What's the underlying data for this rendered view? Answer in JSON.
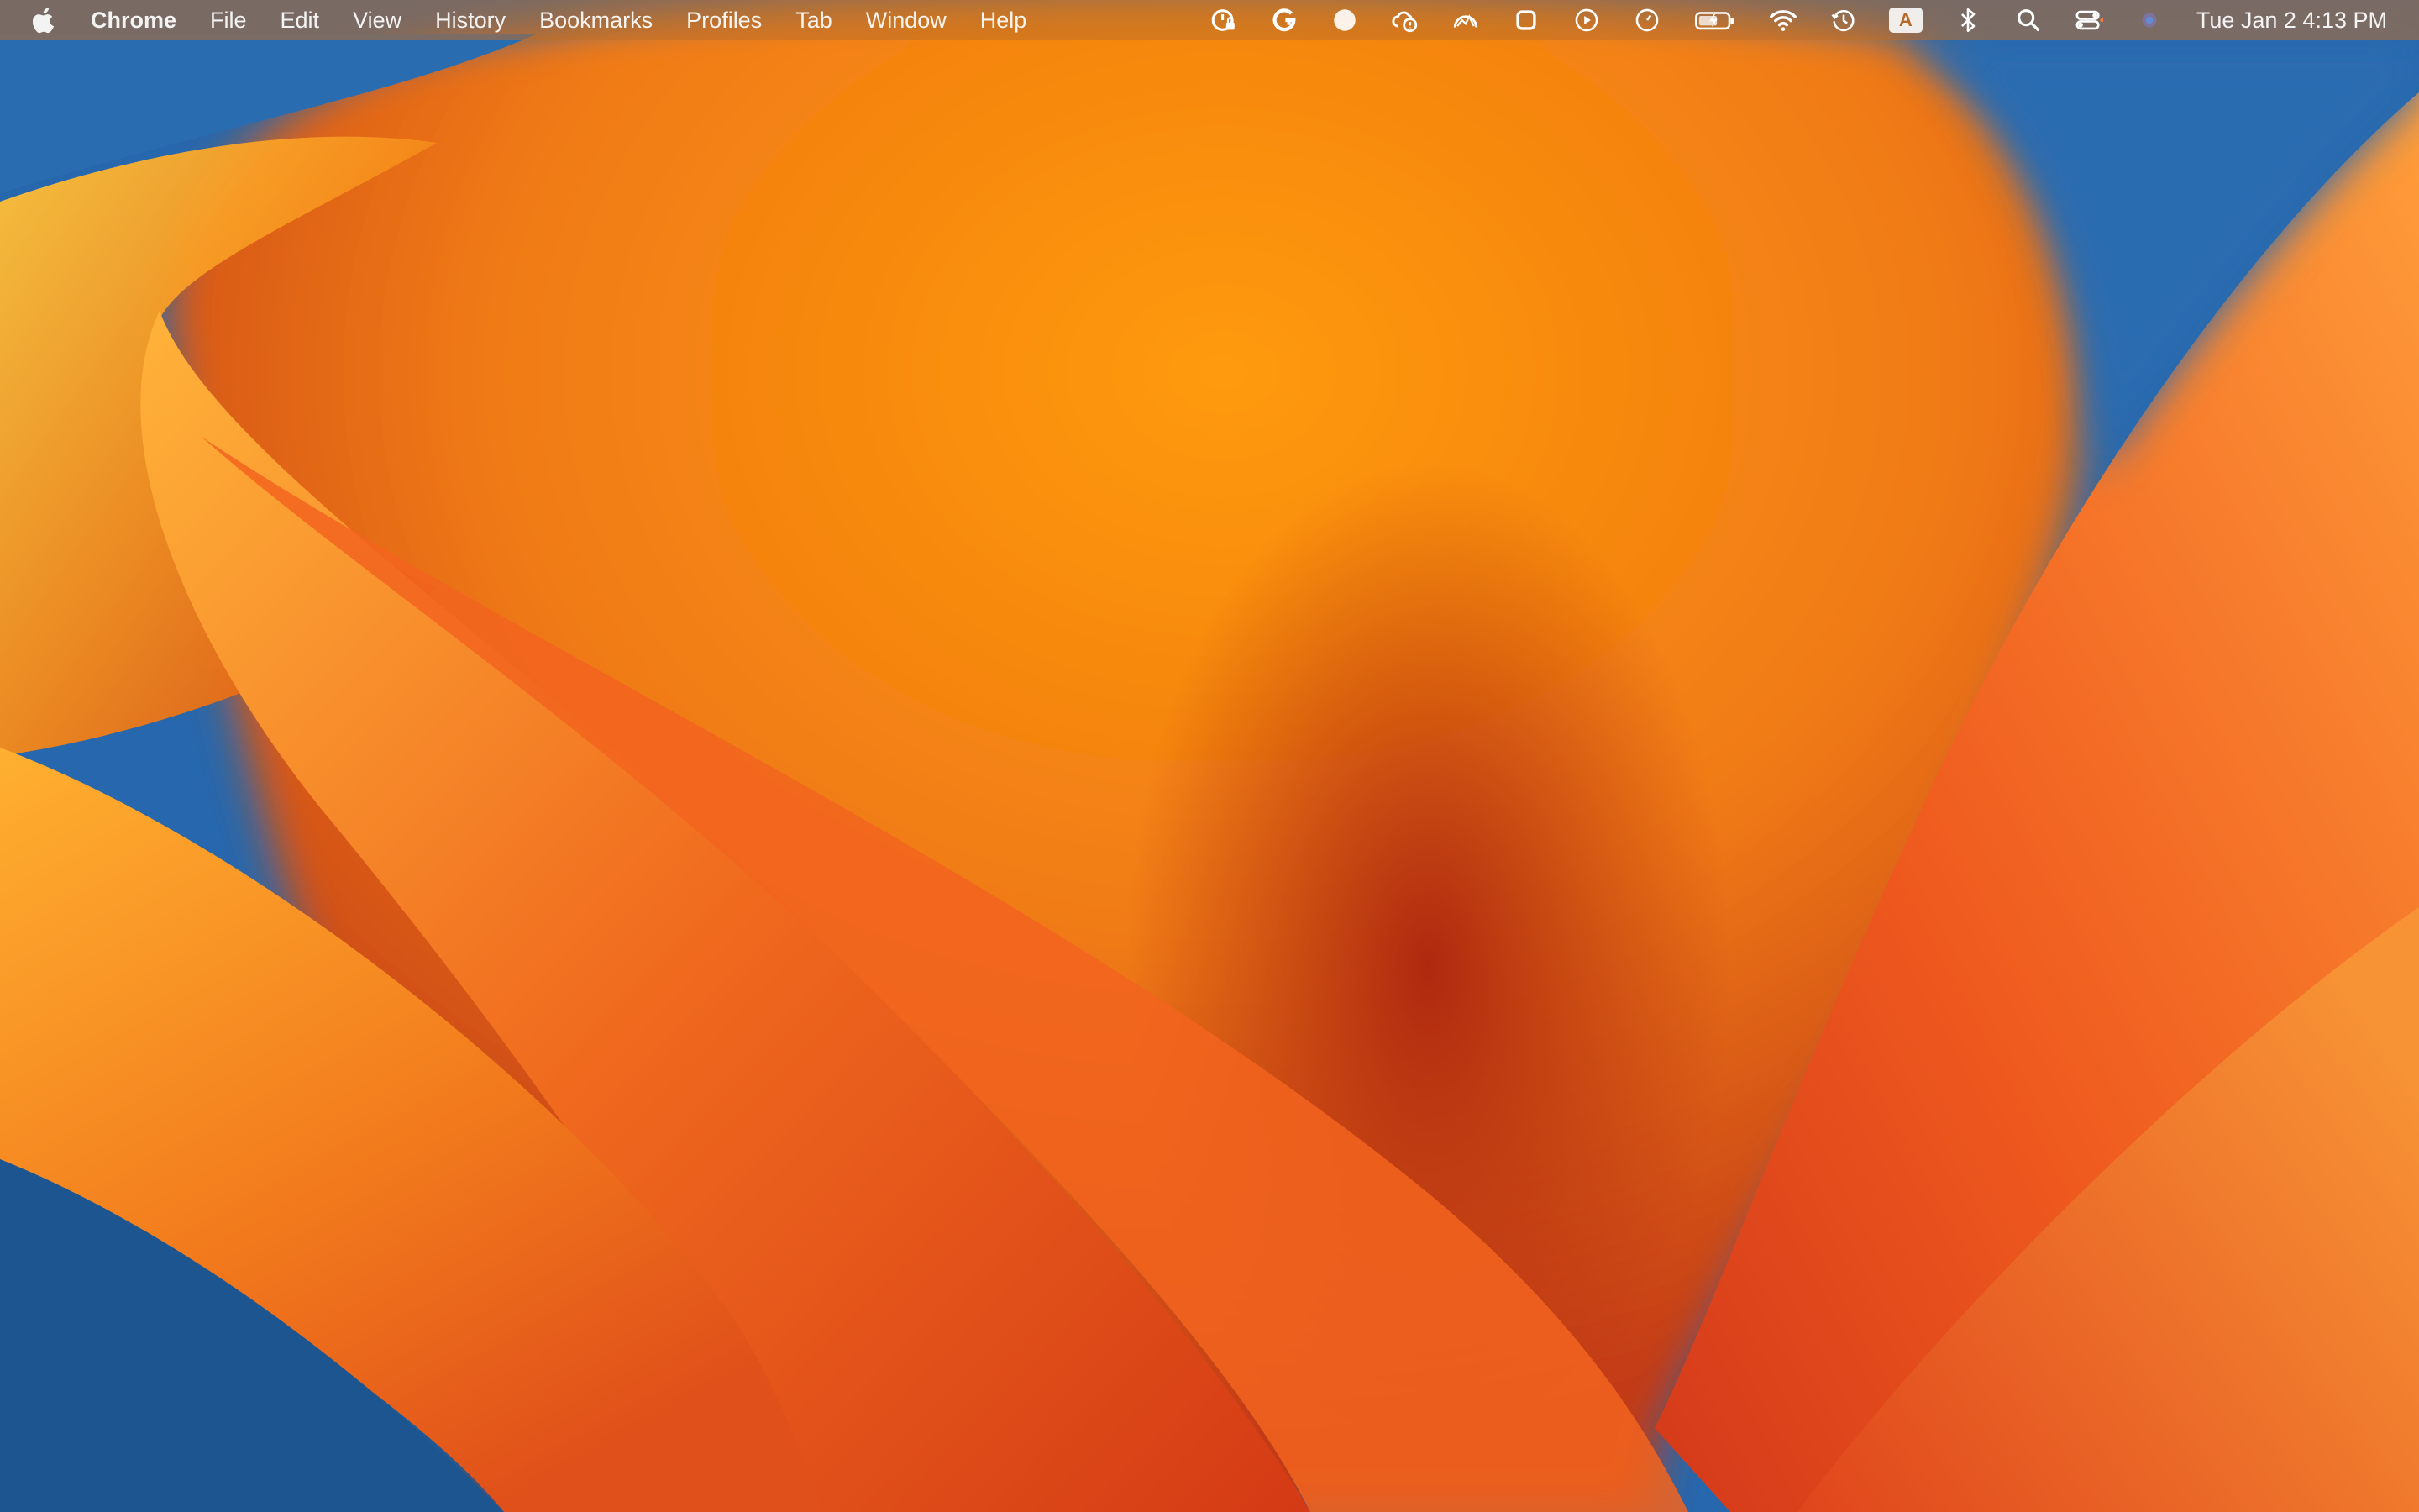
{
  "menubar": {
    "app_name": "Chrome",
    "menus": [
      "File",
      "Edit",
      "View",
      "History",
      "Bookmarks",
      "Profiles",
      "Tab",
      "Window",
      "Help"
    ],
    "status_icons": [
      "password-lock-icon",
      "grammarly-icon",
      "circle-dot-icon",
      "cloud-alert-icon",
      "activity-monitor-icon",
      "rounded-square-icon",
      "play-circle-icon",
      "timer-icon",
      "battery-charging-icon",
      "wifi-icon",
      "time-machine-icon"
    ],
    "input_source": "A",
    "right_icons": [
      "bluetooth-icon",
      "spotlight-search-icon",
      "control-center-icon",
      "siri-icon"
    ],
    "clock": "Tue Jan 2  4:13 PM"
  }
}
